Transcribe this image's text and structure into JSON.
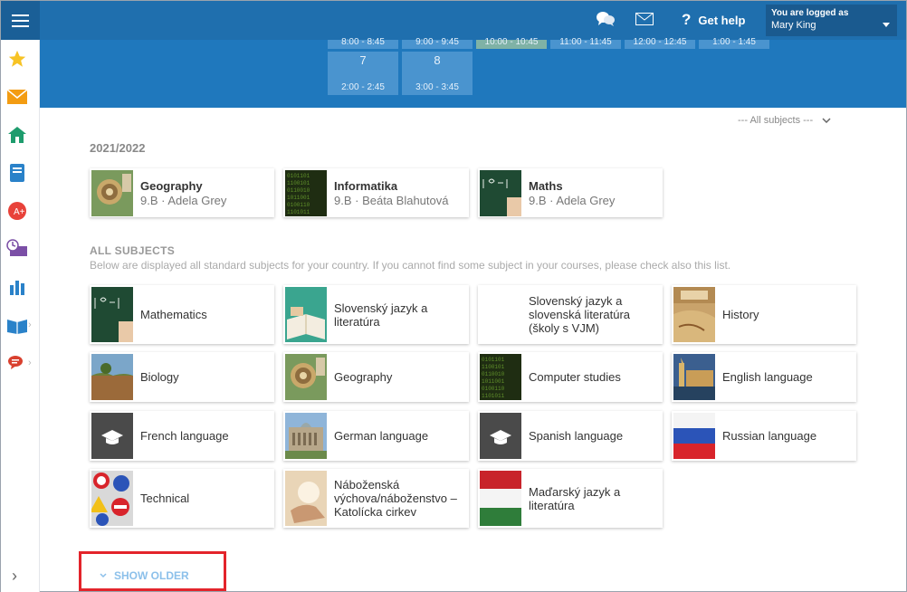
{
  "header": {
    "help_label": "Get help",
    "user_logged_label": "You are logged as",
    "user_name": "Mary King"
  },
  "schedule": {
    "row1_times": [
      "8:00 - 8:45",
      "9:00 - 9:45",
      "10:00 - 10:45",
      "11:00 - 11:45",
      "12:00 - 12:45",
      "1:00 - 1:45"
    ],
    "row2": [
      {
        "num": "7",
        "time": "2:00 - 2:45"
      },
      {
        "num": "8",
        "time": "3:00 - 3:45"
      }
    ]
  },
  "filter": {
    "label": "--- All subjects ---"
  },
  "my_courses": {
    "year": "2021/2022",
    "courses": [
      {
        "title": "Geography",
        "detail": "9.B · Adela Grey",
        "icon": "geography-thumb"
      },
      {
        "title": "Informatika",
        "detail": "9.B · Beáta Blahutová",
        "icon": "informatics-thumb"
      },
      {
        "title": "Maths",
        "detail": "9.B · Adela Grey",
        "icon": "maths-thumb"
      }
    ]
  },
  "all_subjects": {
    "title": "ALL SUBJECTS",
    "description": "Below are displayed all standard subjects for your country. If you cannot find some subject in your courses, please check also this list.",
    "subjects": [
      {
        "name": "Mathematics",
        "icon": "maths-thumb"
      },
      {
        "name": "Slovenský jazyk a literatúra",
        "icon": "book-thumb"
      },
      {
        "name": "Slovenský jazyk a slovenská literatúra (školy s VJM)",
        "icon": "none"
      },
      {
        "name": "History",
        "icon": "history-thumb"
      },
      {
        "name": "Biology",
        "icon": "biology-thumb"
      },
      {
        "name": "Geography",
        "icon": "geography-thumb"
      },
      {
        "name": "Computer studies",
        "icon": "informatics-thumb"
      },
      {
        "name": "English language",
        "icon": "london-thumb"
      },
      {
        "name": "French language",
        "icon": "graduation-cap-thumb"
      },
      {
        "name": "German language",
        "icon": "reichstag-thumb"
      },
      {
        "name": "Spanish language",
        "icon": "graduation-cap-thumb"
      },
      {
        "name": "Russian language",
        "icon": "russian-flag-thumb"
      },
      {
        "name": "Technical",
        "icon": "traffic-signs-thumb"
      },
      {
        "name": "Náboženská výchova/náboženstvo – Katolícka cirkev",
        "icon": "hands-thumb"
      },
      {
        "name": "Maďarský jazyk a literatúra",
        "icon": "hungarian-flag-thumb"
      }
    ]
  },
  "show_older": {
    "label": "SHOW OLDER"
  },
  "colors": {
    "topbar": "#1f6fae",
    "schedule_bg": "#1f78bd",
    "highlight": "#e3242b"
  }
}
